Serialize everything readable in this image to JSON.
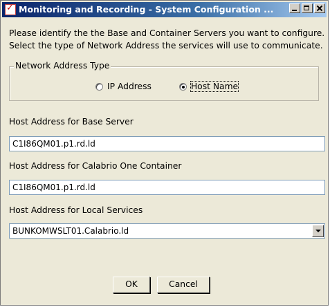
{
  "window": {
    "title": "Monitoring and Recording - System Configuration ..."
  },
  "instructions": {
    "line1": "Please identify the the Base and Container Servers you want to configure.",
    "line2": "Select the type of Network Address the services will use to communicate."
  },
  "network_address_type": {
    "label": "Network Address Type",
    "options": [
      {
        "label": "IP Address",
        "selected": false
      },
      {
        "label": "Host Name",
        "selected": true
      }
    ]
  },
  "fields": {
    "base_server": {
      "label": "Host Address for Base Server",
      "value": "C1I86QM01.p1.rd.ld"
    },
    "container": {
      "label": "Host Address for Calabrio One Container",
      "value": "C1I86QM01.p1.rd.ld"
    },
    "local_services": {
      "label": "Host Address for Local Services",
      "value": "BUNKOMWSLT01.Calabrio.ld"
    }
  },
  "buttons": {
    "ok": "OK",
    "cancel": "Cancel"
  }
}
